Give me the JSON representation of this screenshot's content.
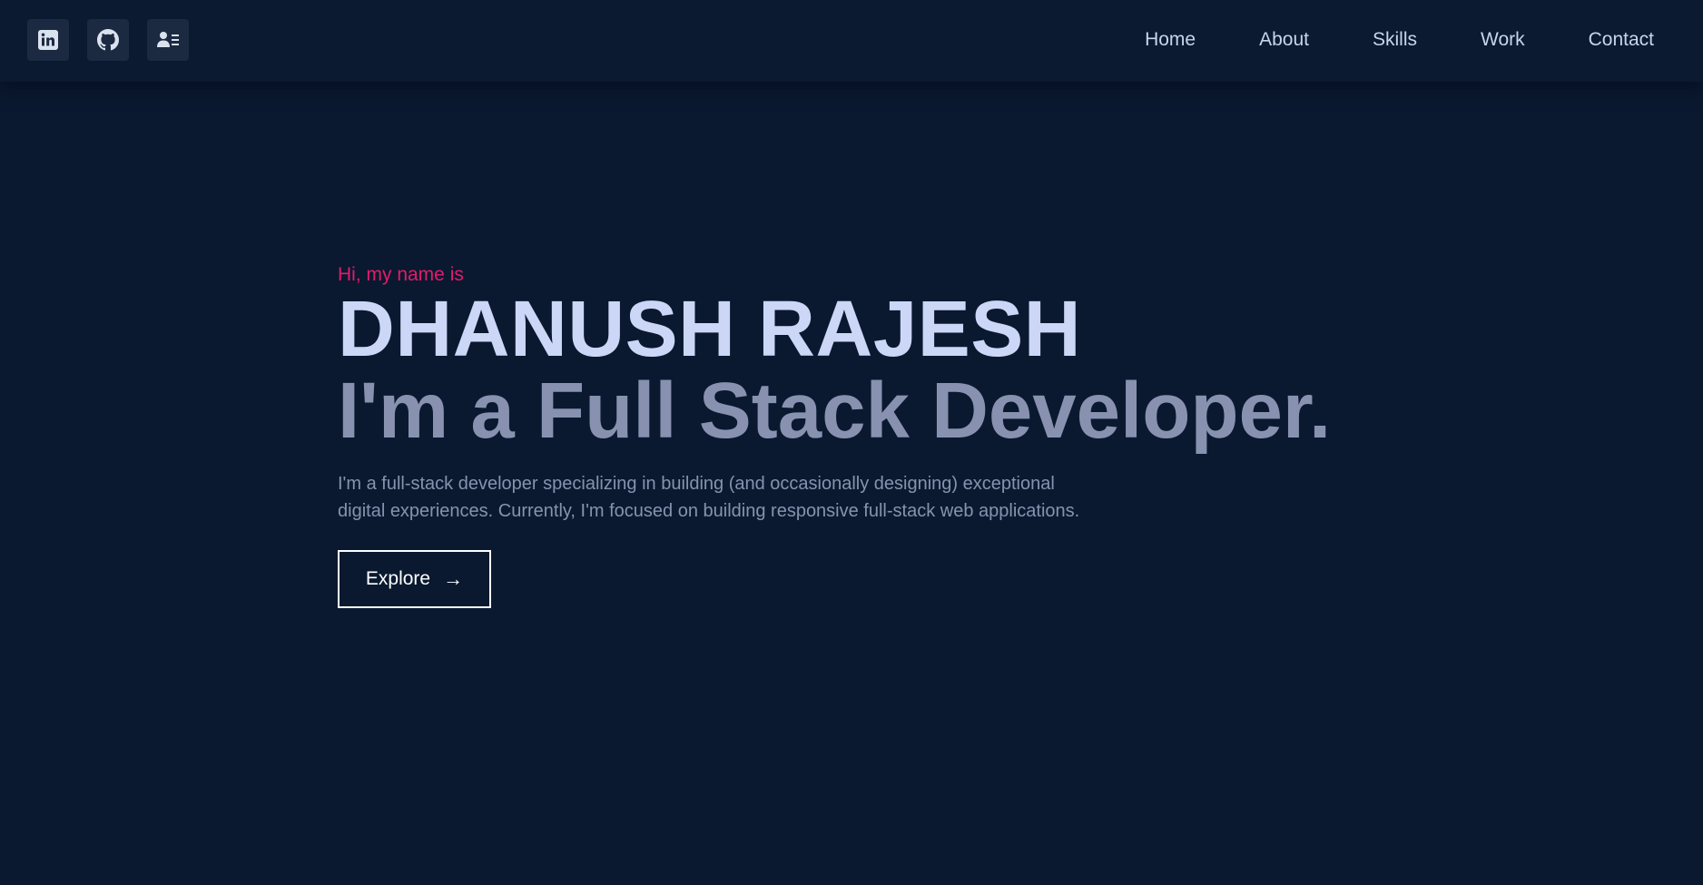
{
  "social": [
    {
      "icon": "linkedin-icon"
    },
    {
      "icon": "github-icon"
    },
    {
      "icon": "contact-card-icon"
    }
  ],
  "nav": {
    "items": [
      "Home",
      "About",
      "Skills",
      "Work",
      "Contact"
    ]
  },
  "hero": {
    "greeting": "Hi, my name is",
    "name": "DHANUSH RAJESH",
    "role": "I'm a Full Stack Developer.",
    "description_line1": "I'm a full-stack developer specializing in building (and occasionally designing) exceptional",
    "description_line2": "digital experiences. Currently, I'm focused on building responsive full-stack web applications.",
    "button_label": "Explore",
    "button_arrow": "→"
  },
  "colors": {
    "background": "#0a192f",
    "accent": "#e31b6d",
    "name": "#ccd6f6",
    "muted": "#8892b0",
    "nav_text": "#c9d4ec",
    "icon_bg": "#1b2a40"
  }
}
